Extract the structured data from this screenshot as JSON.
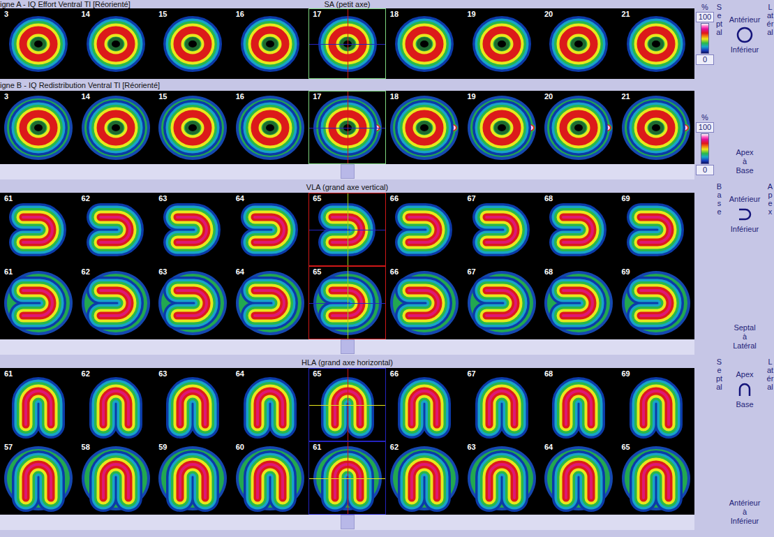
{
  "sections": [
    {
      "title": "SA (petit axe)",
      "kind": "ring",
      "color": "#7ed67e",
      "rows": [
        {
          "label": "igne A - IQ Effort Ventral Tl [Réorienté]",
          "kind": "plain",
          "slices": [
            {
              "number": "3",
              "selected": false
            },
            {
              "number": "14",
              "selected": false
            },
            {
              "number": "15",
              "selected": false
            },
            {
              "number": "16",
              "selected": false
            },
            {
              "number": "17",
              "selected": true
            },
            {
              "number": "18",
              "selected": false
            },
            {
              "number": "19",
              "selected": false
            },
            {
              "number": "20",
              "selected": false
            },
            {
              "number": "21",
              "selected": false
            }
          ]
        },
        {
          "label": "igne B - IQ Redistribution Ventral Tl [Réorienté]",
          "kind": "halo",
          "slices": [
            {
              "number": "3",
              "selected": false
            },
            {
              "number": "14",
              "selected": false
            },
            {
              "number": "15",
              "selected": false
            },
            {
              "number": "16",
              "selected": false
            },
            {
              "number": "17",
              "selected": true
            },
            {
              "number": "18",
              "selected": false
            },
            {
              "number": "19",
              "selected": false
            },
            {
              "number": "20",
              "selected": false
            },
            {
              "number": "21",
              "selected": false
            }
          ]
        }
      ],
      "scales": [
        {
          "unit": "%",
          "max": "100",
          "min": "0"
        },
        {
          "unit": "%",
          "max": "100",
          "min": "0"
        }
      ],
      "legend": {
        "left": "Septal",
        "right": "Latéral",
        "top": "Antérieur",
        "bottom": "Inférieur",
        "direction": [
          "Apex",
          "à",
          "Base"
        ]
      }
    },
    {
      "title": "VLA (grand axe vertical)",
      "kind": "horseshoe",
      "color": "#d01818",
      "rows": [
        {
          "kind": "plain",
          "slices": [
            {
              "number": "61",
              "selected": false
            },
            {
              "number": "62",
              "selected": false
            },
            {
              "number": "63",
              "selected": false
            },
            {
              "number": "64",
              "selected": false
            },
            {
              "number": "65",
              "selected": true
            },
            {
              "number": "66",
              "selected": false
            },
            {
              "number": "67",
              "selected": false
            },
            {
              "number": "68",
              "selected": false
            },
            {
              "number": "69",
              "selected": false
            }
          ]
        },
        {
          "kind": "halo",
          "slices": [
            {
              "number": "61",
              "selected": false
            },
            {
              "number": "62",
              "selected": false
            },
            {
              "number": "63",
              "selected": false
            },
            {
              "number": "64",
              "selected": false
            },
            {
              "number": "65",
              "selected": true
            },
            {
              "number": "66",
              "selected": false
            },
            {
              "number": "67",
              "selected": false
            },
            {
              "number": "68",
              "selected": false
            },
            {
              "number": "69",
              "selected": false
            }
          ]
        }
      ],
      "legend": {
        "left": "Base",
        "right": "Apex",
        "top": "Antérieur",
        "bottom": "Inférieur",
        "direction": [
          "Septal",
          "à",
          "Latéral"
        ]
      }
    },
    {
      "title": "HLA (grand axe horizontal)",
      "kind": "arch",
      "color": "#2424c0",
      "rows": [
        {
          "kind": "plain",
          "slices": [
            {
              "number": "61",
              "selected": false
            },
            {
              "number": "62",
              "selected": false
            },
            {
              "number": "63",
              "selected": false
            },
            {
              "number": "64",
              "selected": false
            },
            {
              "number": "65",
              "selected": true
            },
            {
              "number": "66",
              "selected": false
            },
            {
              "number": "67",
              "selected": false
            },
            {
              "number": "68",
              "selected": false
            },
            {
              "number": "69",
              "selected": false
            }
          ]
        },
        {
          "kind": "halo",
          "slices": [
            {
              "number": "57",
              "selected": false
            },
            {
              "number": "58",
              "selected": false
            },
            {
              "number": "59",
              "selected": false
            },
            {
              "number": "60",
              "selected": false
            },
            {
              "number": "61",
              "selected": true
            },
            {
              "number": "62",
              "selected": false
            },
            {
              "number": "63",
              "selected": false
            },
            {
              "number": "64",
              "selected": false
            },
            {
              "number": "65",
              "selected": false
            }
          ]
        }
      ],
      "legend": {
        "left": "Septal",
        "right": "Latéral",
        "top": "Apex",
        "bottom": "Base",
        "direction": [
          "Antérieur",
          "à",
          "Inférieur"
        ]
      }
    }
  ]
}
